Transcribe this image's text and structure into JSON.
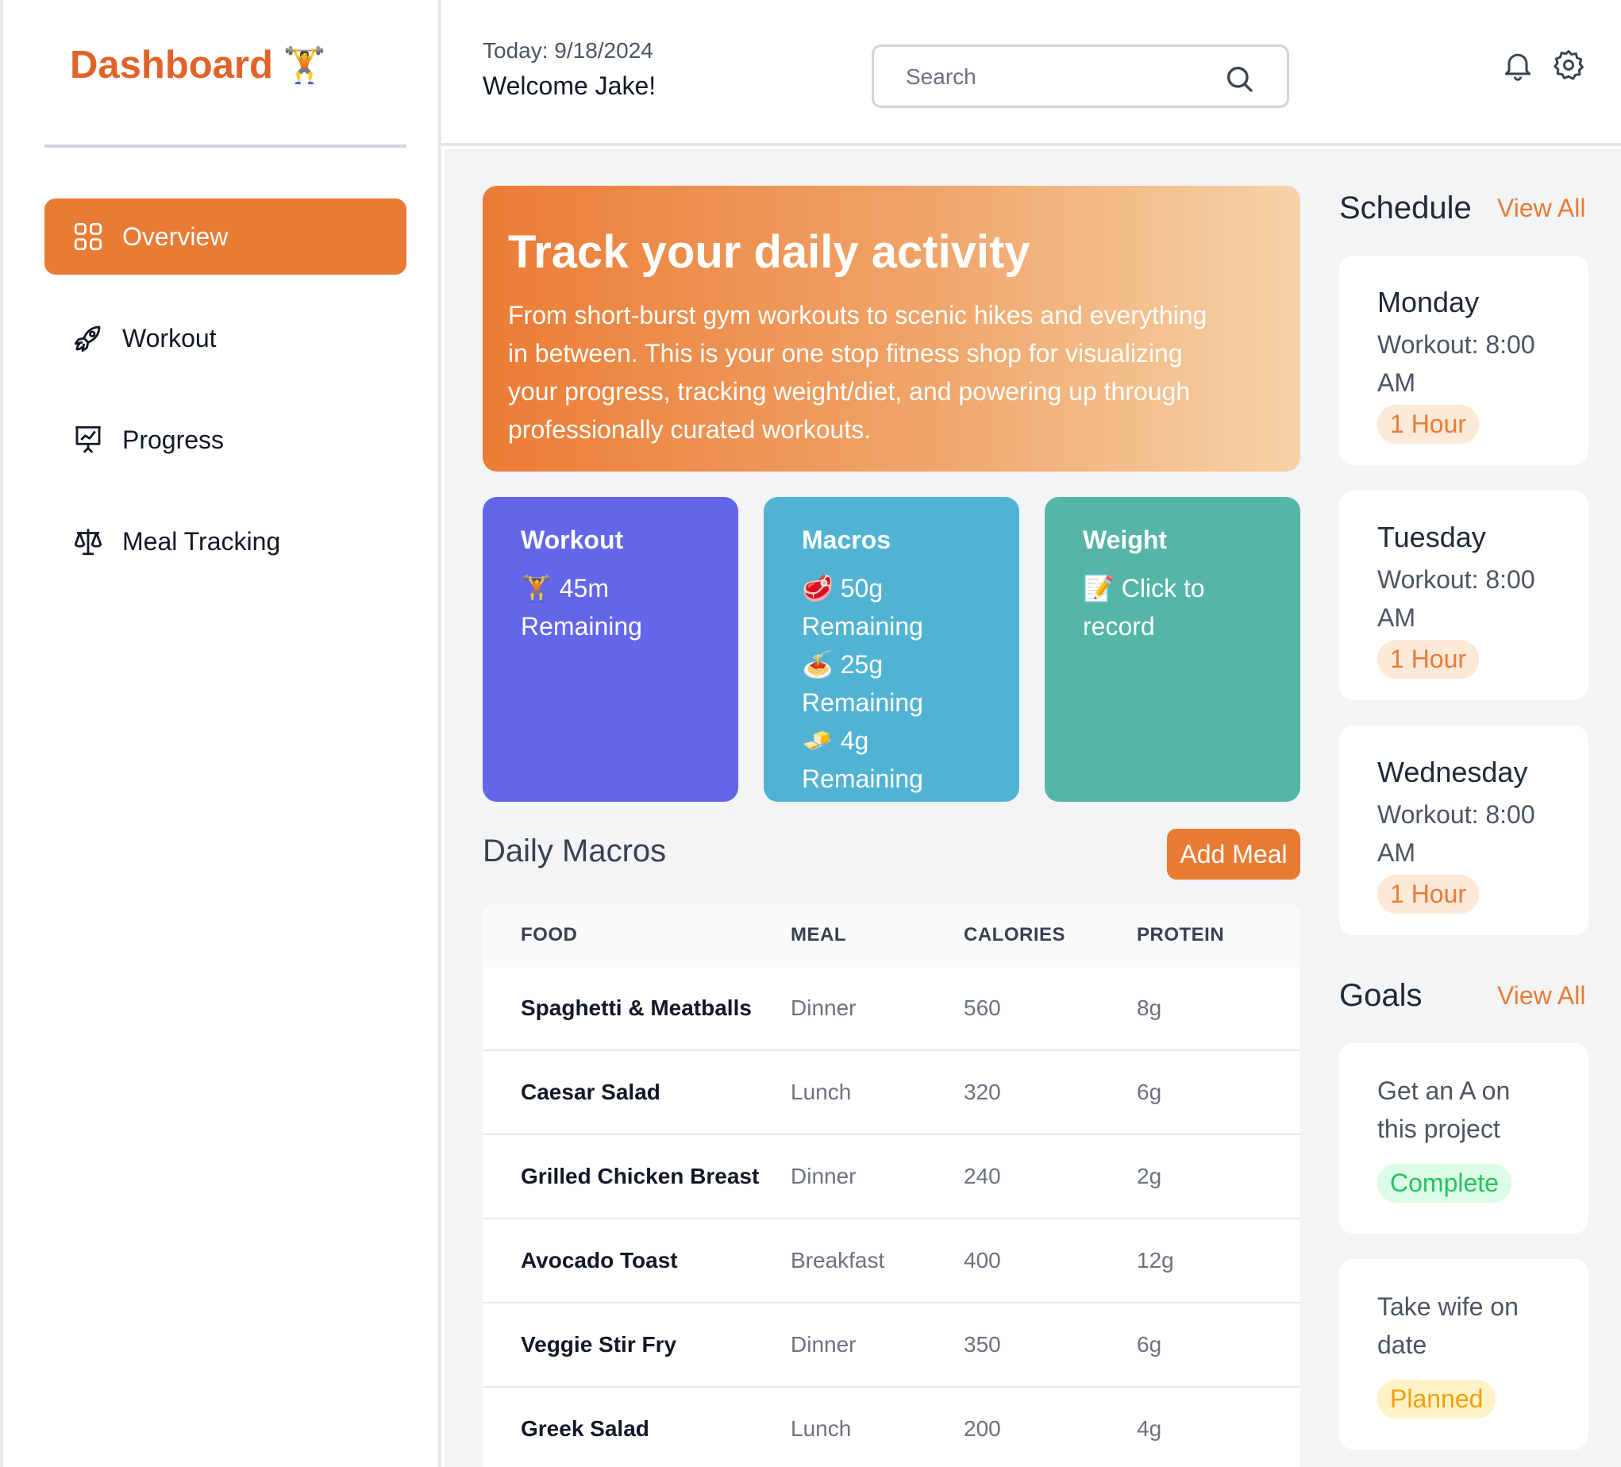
{
  "brand": {
    "title": "Dashboard",
    "emoji": "🏋️"
  },
  "sidebar": {
    "items": [
      {
        "label": "Overview",
        "icon": "grid-icon",
        "active": true
      },
      {
        "label": "Workout",
        "icon": "rocket-icon"
      },
      {
        "label": "Progress",
        "icon": "presentation-chart-icon"
      },
      {
        "label": "Meal Tracking",
        "icon": "scale-icon"
      }
    ]
  },
  "header": {
    "date": "Today: 9/18/2024",
    "welcome": "Welcome Jake!",
    "search_placeholder": "Search",
    "search_value": ""
  },
  "hero": {
    "title": "Track your daily activity",
    "text": "From short-burst gym workouts to scenic hikes and everything in between. This is your one stop fitness shop for visualizing your progress, tracking weight/diet, and powering up through professionally curated workouts."
  },
  "cards": {
    "workout": {
      "title": "Workout",
      "line": "🏋️ 45m Remaining"
    },
    "macros": {
      "title": "Macros",
      "lines": [
        "🥩 50g Remaining",
        "🍝 25g Remaining",
        "🧈 4g Remaining"
      ]
    },
    "weight": {
      "title": "Weight",
      "line": "📝 Click to record"
    }
  },
  "daily_macros": {
    "title": "Daily Macros",
    "add_label": "Add Meal",
    "columns": [
      "FOOD",
      "MEAL",
      "CALORIES",
      "PROTEIN"
    ],
    "rows": [
      [
        "Spaghetti & Meatballs",
        "Dinner",
        "560",
        "8g"
      ],
      [
        "Caesar Salad",
        "Lunch",
        "320",
        "6g"
      ],
      [
        "Grilled Chicken Breast",
        "Dinner",
        "240",
        "2g"
      ],
      [
        "Avocado Toast",
        "Breakfast",
        "400",
        "12g"
      ],
      [
        "Veggie Stir Fry",
        "Dinner",
        "350",
        "6g"
      ],
      [
        "Greek Salad",
        "Lunch",
        "200",
        "4g"
      ]
    ]
  },
  "schedule": {
    "title": "Schedule",
    "view_all": "View All",
    "items": [
      {
        "day": "Monday",
        "time": "Workout: 8:00 AM",
        "duration": "1 Hour"
      },
      {
        "day": "Tuesday",
        "time": "Workout: 8:00 AM",
        "duration": "1 Hour"
      },
      {
        "day": "Wednesday",
        "time": "Workout: 8:00 AM",
        "duration": "1 Hour"
      }
    ]
  },
  "goals": {
    "title": "Goals",
    "view_all": "View All",
    "items": [
      {
        "text": "Get an A on this project",
        "status": "Complete"
      },
      {
        "text": "Take wife on date",
        "status": "Planned"
      }
    ]
  },
  "colors": {
    "accent": "#e97b35",
    "workout_card": "#6366e9",
    "macros_card": "#51b3d4",
    "weight_card": "#55b5a6"
  }
}
